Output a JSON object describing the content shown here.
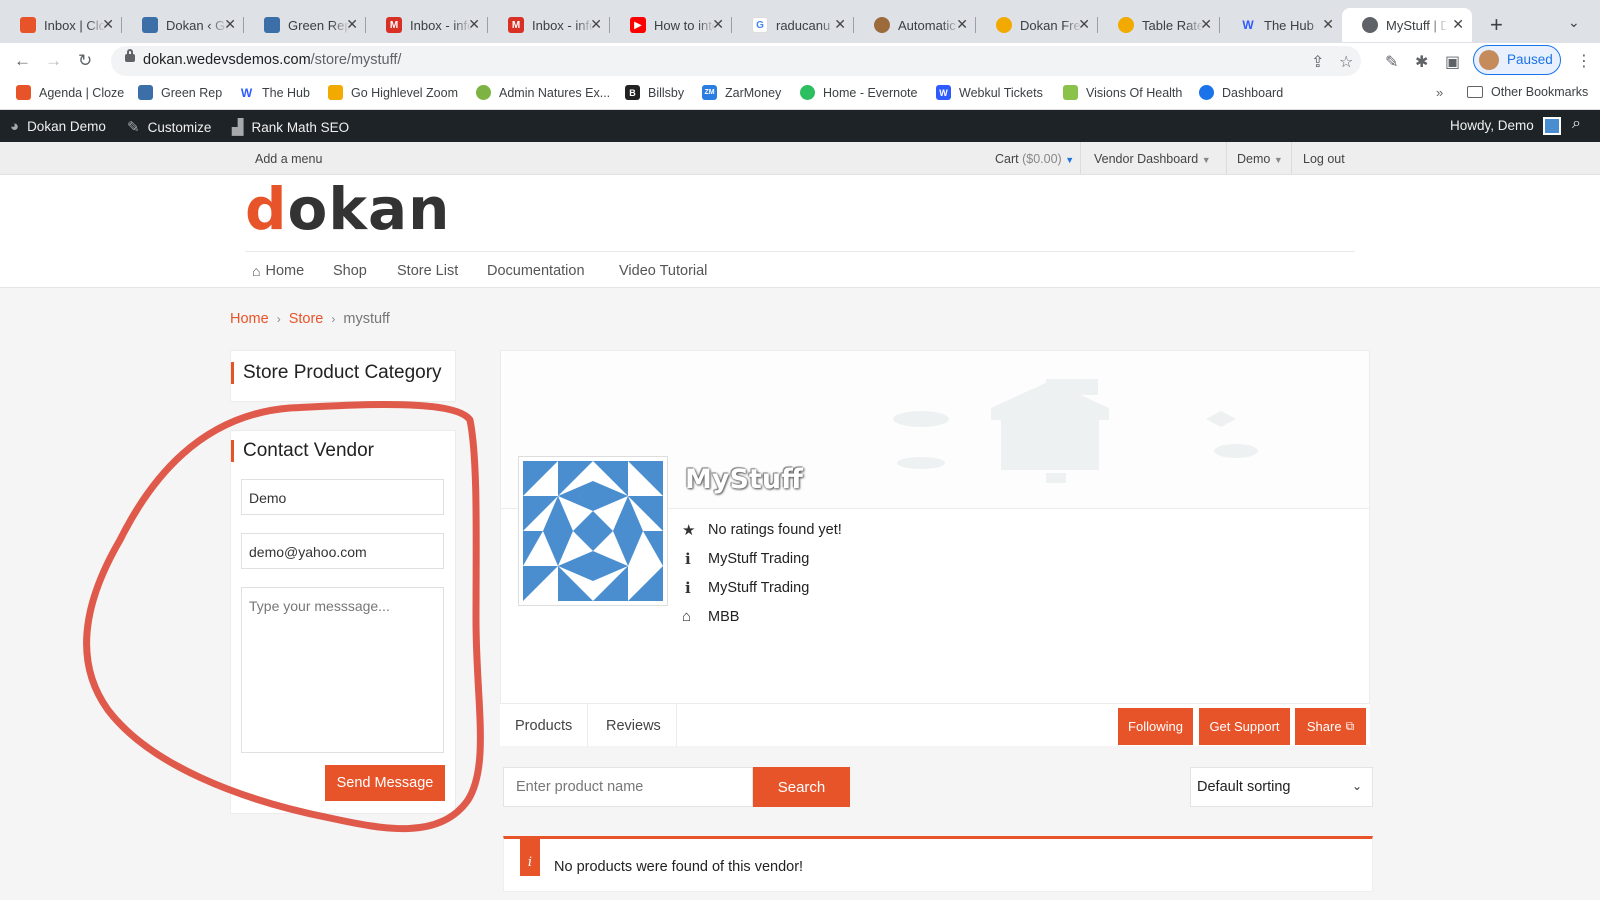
{
  "browser": {
    "tabs": [
      {
        "title": "Inbox | Cloze",
        "fav_color": "#e8542a"
      },
      {
        "title": "Dokan ‹ Green",
        "fav_color": "#3c6fa8"
      },
      {
        "title": "Green Rep",
        "fav_color": "#3c6fa8"
      },
      {
        "title": "Inbox - info",
        "fav_color": "#d93025"
      },
      {
        "title": "Inbox - info",
        "fav_color": "#d93025"
      },
      {
        "title": "How to integrate",
        "fav_color": "#ff0000"
      },
      {
        "title": "raducanu",
        "fav_color": "#4285f4"
      },
      {
        "title": "Automatic",
        "fav_color": "#9c6b3c"
      },
      {
        "title": "Dokan Free",
        "fav_color": "#f2a900"
      },
      {
        "title": "Table Rate",
        "fav_color": "#f2a900"
      },
      {
        "title": "The Hub",
        "fav_color": "#2e5bff"
      },
      {
        "title": "MyStuff | Dokan",
        "fav_color": "#5f6368"
      }
    ],
    "url_domain": "dokan.wedevsdemos.com",
    "url_path": "/store/mystuff/",
    "profile_label": "Paused"
  },
  "bookmarks": [
    {
      "label": "Agenda | Cloze",
      "color": "#e8542a",
      "glyph": ""
    },
    {
      "label": "Green Rep",
      "color": "#3c6fa8",
      "glyph": ""
    },
    {
      "label": "The Hub",
      "color": "#2e5bff",
      "glyph": "W"
    },
    {
      "label": "Go Highlevel Zoom",
      "color": "#f2a900",
      "glyph": ""
    },
    {
      "label": "Admin Natures Ex...",
      "color": "#7cb342",
      "glyph": ""
    },
    {
      "label": "Billsby",
      "color": "#222222",
      "glyph": "B"
    },
    {
      "label": "ZarMoney",
      "color": "#2a7de1",
      "glyph": "ZM"
    },
    {
      "label": "Home - Evernote",
      "color": "#2dbe60",
      "glyph": ""
    },
    {
      "label": "Webkul Tickets",
      "color": "#2e5bff",
      "glyph": "W"
    },
    {
      "label": "Visions Of Health",
      "color": "#8bc34a",
      "glyph": ""
    },
    {
      "label": "Dashboard",
      "color": "#1a73e8",
      "glyph": ""
    }
  ],
  "bookmarks_other": "Other Bookmarks",
  "adminbar": {
    "site": "Dokan Demo",
    "customize": "Customize",
    "seo": "Rank Math SEO",
    "howdy": "Howdy, Demo"
  },
  "topmenu": {
    "add_menu": "Add a menu",
    "cart_label": "Cart",
    "cart_amount": "($0.00)",
    "vendor_dashboard": "Vendor Dashboard",
    "demo": "Demo",
    "logout": "Log out"
  },
  "logo": {
    "first": "d",
    "rest": "okan"
  },
  "nav": [
    "Home",
    "Shop",
    "Store List",
    "Documentation",
    "Video Tutorial"
  ],
  "breadcrumb": {
    "home": "Home",
    "store": "Store",
    "current": "mystuff"
  },
  "sidebar": {
    "category_title": "Store Product Category",
    "contact_title": "Contact Vendor",
    "name_value": "Demo",
    "email_value": "demo@yahoo.com",
    "message_placeholder": "Type your messsage...",
    "send_label": "Send Message"
  },
  "store": {
    "name": "MyStuff",
    "rating": "No ratings found yet!",
    "info1": "MyStuff Trading",
    "info2": "MyStuff Trading",
    "bank": "MBB",
    "tabs": [
      "Products",
      "Reviews"
    ],
    "following_label": "Following",
    "support_label": "Get Support",
    "share_label": "Share"
  },
  "search": {
    "placeholder": "Enter product name",
    "button": "Search",
    "sort_value": "Default sorting"
  },
  "notice": "No products were found of this vendor!",
  "colors": {
    "accent": "#e8542a",
    "annotation": "#e05a4c"
  }
}
